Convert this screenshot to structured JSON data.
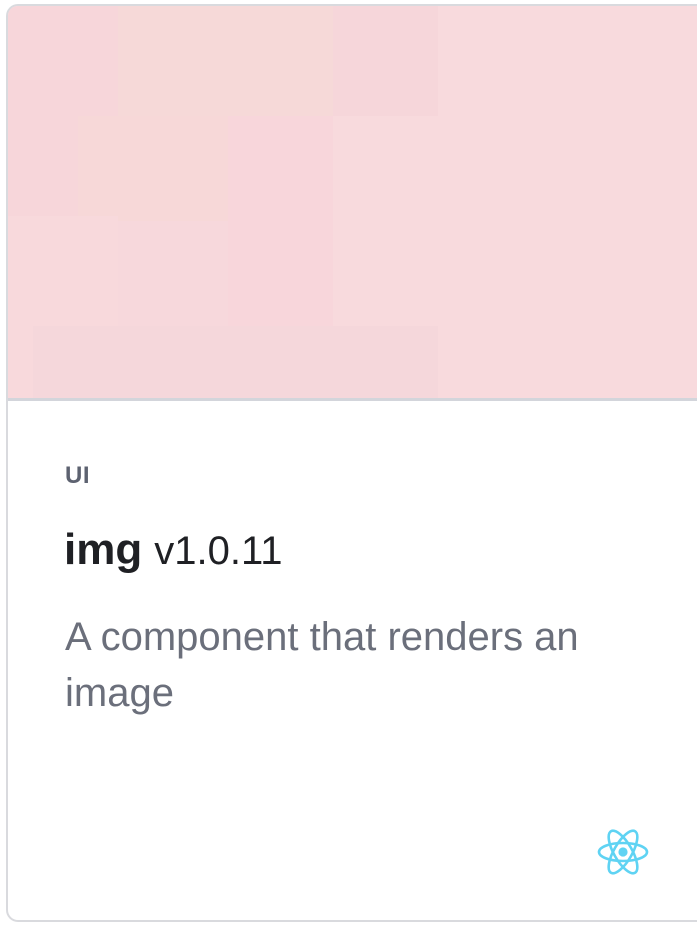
{
  "card": {
    "category": "UI",
    "name": "img",
    "version": "v1.0.11",
    "description": "A component that renders an image",
    "framework_icon": "react-icon",
    "preview_color": "#f8dadd",
    "framework_color": "#5fd3f3"
  }
}
